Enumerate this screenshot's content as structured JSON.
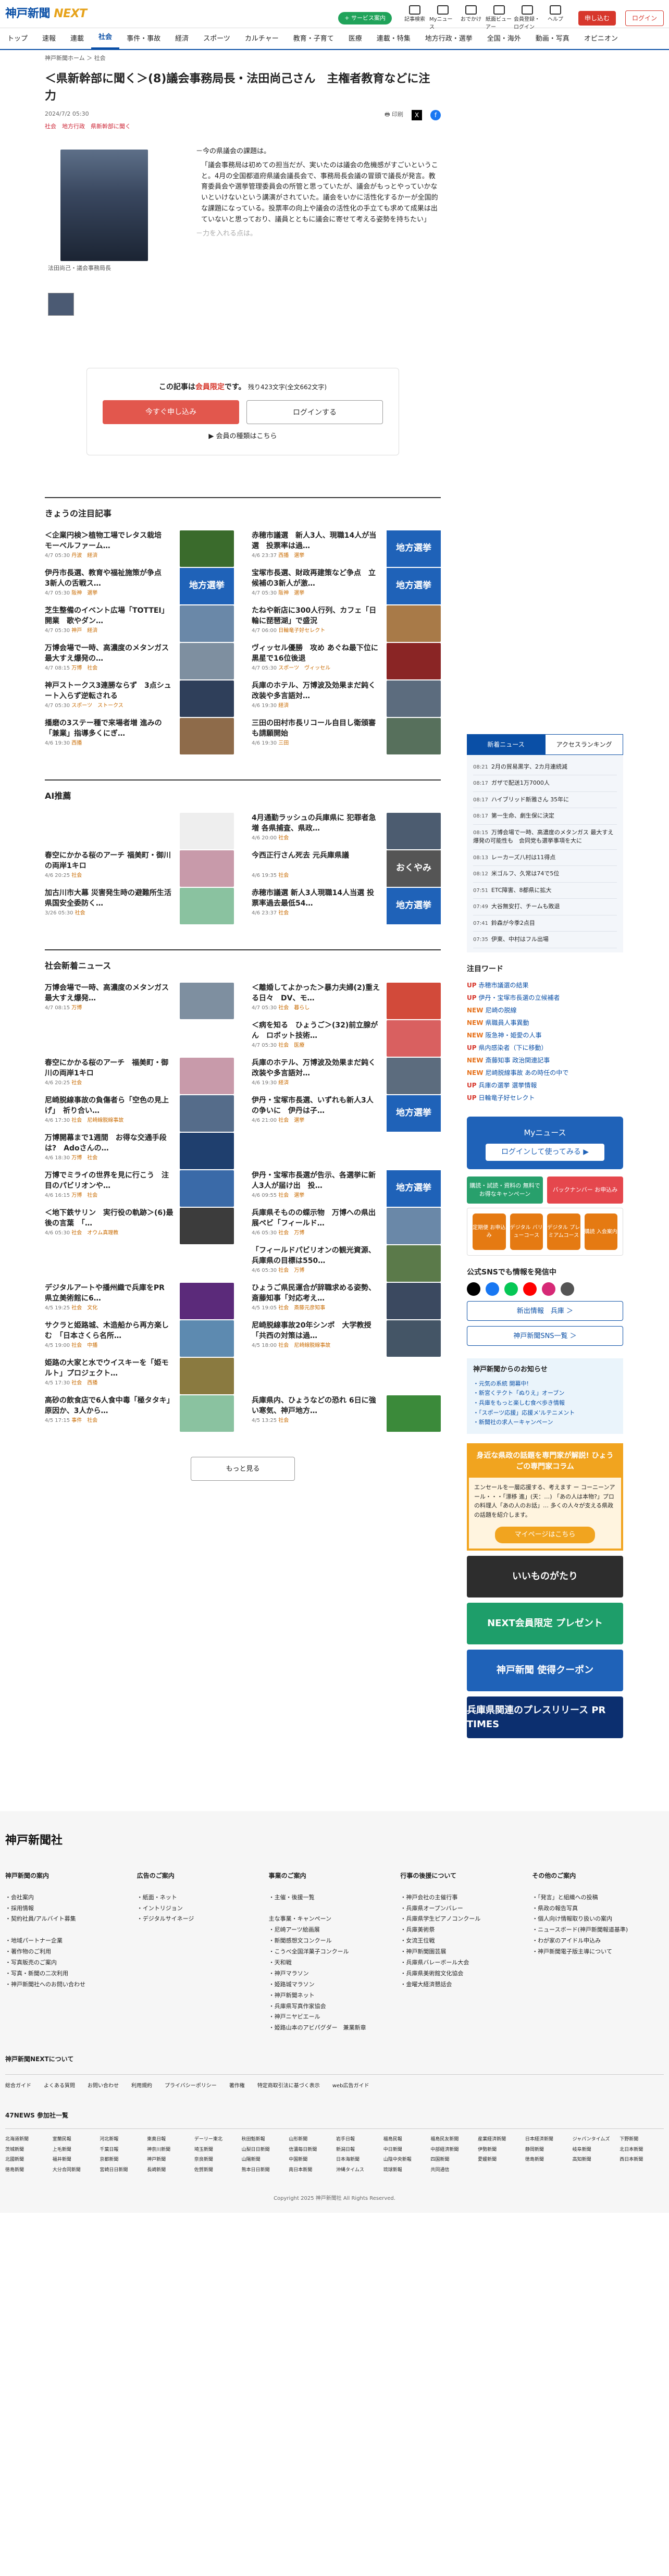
{
  "header": {
    "logo": "神戸新聞",
    "logo_next": "NEXT",
    "digital_pill": "デジタル版",
    "icons": [
      {
        "label": "記事検索",
        "icon": "search-icon"
      },
      {
        "label": "Myニュース",
        "icon": "bookmark-icon"
      },
      {
        "label": "おでかけ",
        "icon": "outing-icon"
      },
      {
        "label": "紙面ビューアー",
        "icon": "viewer-icon"
      },
      {
        "label": "会員登録・ログイン",
        "icon": "user-icon"
      },
      {
        "label": "ヘルプ",
        "icon": "help-icon"
      }
    ],
    "green_pill": "+ サービス案内",
    "register": "申し込む",
    "login": "ログイン"
  },
  "nav": [
    "トップ",
    "速報",
    "連載",
    "社会",
    "事件・事故",
    "経済",
    "スポーツ",
    "カルチャー",
    "教育・子育て",
    "医療",
    "連載・特集",
    "地方行政・選挙",
    "全国・海外",
    "動画・写真",
    "オピニオン"
  ],
  "nav_active": 3,
  "breadcrumb": "神戸新聞ホーム ＞ 社会",
  "article": {
    "title": "＜県新幹部に聞く＞(8)議会事務局長・法田尚己さん　主権者教育などに注力",
    "date": "2024/7/2 05:30",
    "tags": "社会　地方行政　県新幹部に聞く",
    "print": "印刷",
    "caption": "法田尚己・議会事務局長",
    "lead": [
      "－今の県議会の課題は。",
      "「議会事務局は初めての担当だが、実いたのは議会の危機感がすごいということ。4月の全国都道府県議会議長会で、事務局長会議の冒頭で議長が発言。教育委員会や選挙管理委員会の所管と思っていたが、議会がもっとやっていかないといけないという講演がされていた。議会をいかに活性化するかーが全国的な課題になっている。投票率の向上や議会の活性化の手立ても求めて成果は出ていないと思っており、議員とともに議会に寄せて考える姿勢を持ちたい」",
      "－力を入れる点は。"
    ],
    "paywall_text_a": "この記事は",
    "paywall_text_red": "会員限定",
    "paywall_text_b": "です。",
    "paywall_count": "残り423文字(全文662文字)",
    "btn_subscribe": "今すぐ申し込み",
    "btn_login": "ログインする",
    "plans_link": "▶ 会員の種類はこちら"
  },
  "today": {
    "heading": "きょうの注目記事",
    "items": [
      {
        "title": "＜企業円検＞植物工場でレタス栽培　モーベルファーム…",
        "date": "4/7 05:30",
        "tag": "丹波　経済",
        "kind": "photo",
        "color": "#3a6b2c"
      },
      {
        "title": "赤穂市議選　新人3人、現職14人が当選　投票率は過…",
        "date": "4/6 23:37",
        "tag": "西播　選挙",
        "kind": "badge",
        "badge": "地方選挙"
      },
      {
        "title": "伊丹市長選、教育や福祉施策が争点　3新人の舌戦ス…",
        "date": "4/7 05:30",
        "tag": "阪神　選挙",
        "kind": "badge",
        "badge": "地方選挙"
      },
      {
        "title": "宝塚市長選、財政再建策など争点　立候補の3新人が激…",
        "date": "4/7 05:30",
        "tag": "阪神　選挙",
        "kind": "badge",
        "badge": "地方選挙"
      },
      {
        "title": "芝生整備のイベント広場「TOTTEI」開業　歌やダン…",
        "date": "4/7 05:30",
        "tag": "神戸　経済",
        "kind": "photo",
        "color": "#6a88a8"
      },
      {
        "title": "たねや新店に300人行列、カフェ「日輪に琵琶湖」で盛況",
        "date": "4/7 06:00",
        "tag": "日輪竜子好セレクト",
        "kind": "photo",
        "color": "#a87a48"
      },
      {
        "title": "万博会場で一時、高濃度のメタンガス　最大すえ爆発の…",
        "date": "4/7 08:15",
        "tag": "万博　社会",
        "kind": "photo",
        "color": "#7e8fa0"
      },
      {
        "title": "ヴィッセル優勝　攻め あぐね最下位に黒星で16位後退",
        "date": "4/7 05:30",
        "tag": "スポーツ　ヴィッセル",
        "kind": "photo",
        "color": "#8a2525"
      },
      {
        "title": "神戸ストークス3連勝ならず　3点シュート入らず逆転される",
        "date": "4/7 05:30",
        "tag": "スポーツ　ストークス",
        "kind": "photo",
        "color": "#2f3f5a"
      },
      {
        "title": "兵庫のホテル、万博波及効果まだ鈍く　改装や多言語対…",
        "date": "4/6 19:30",
        "tag": "経済",
        "kind": "photo",
        "color": "#5c6c7e"
      },
      {
        "title": "播磨の3ステー種で来場者増 進みの「兼業」指導多くにぎ…",
        "date": "4/6 19:30",
        "tag": "西播",
        "kind": "photo",
        "color": "#8e6b4a"
      },
      {
        "title": "三田の田村市長リコール自目し衛頒審も請願開始",
        "date": "4/6 19:30",
        "tag": "三田",
        "kind": "photo",
        "color": "#57705c"
      }
    ]
  },
  "ai": {
    "heading": "AI推薦",
    "items": [
      {
        "title": "",
        "date": "",
        "tag": "",
        "kind": "gray"
      },
      {
        "title": "4月通勤ラッシュの兵庫県に 犯罪者急増 各県捕査、県政…",
        "date": "4/6 20:00",
        "tag": "社会",
        "kind": "photo",
        "color": "#4c5c70"
      },
      {
        "title": "春空にかかる桜のアーチ 福美町・御川の両岸1キロ",
        "date": "4/6 20:25",
        "tag": "社会",
        "kind": "photo",
        "color": "#c89aaa"
      },
      {
        "title": "今西正行さん死去 元兵庫県議",
        "date": "4/6 19:35",
        "tag": "社会",
        "kind": "badge2",
        "badge": "おくやみ"
      },
      {
        "title": "加古川市大幕 災害発生時の避難所生活 県国安全委防く…",
        "date": "3/26 05:30",
        "tag": "社会",
        "kind": "map",
        "color": "#8ac2a0"
      },
      {
        "title": "赤穂市議選 新人3人現職14人当選 投票率過去最低54…",
        "date": "4/6 23:37",
        "tag": "社会",
        "kind": "badge",
        "badge": "地方選挙"
      }
    ]
  },
  "social": {
    "heading": "社会新着ニュース",
    "items": [
      {
        "title": "万博会場で一時、高濃度のメタンガス　最大すえ爆発…",
        "date": "4/7 08:15",
        "tag": "万博",
        "kind": "photo",
        "color": "#7e8fa0"
      },
      {
        "title": "＜離婚してよかった＞暴力夫婦(2)重える日々　DV、モ…",
        "date": "4/7 05:30",
        "tag": "社会　暮らし",
        "kind": "photo",
        "color": "#d24a3a"
      },
      {
        "title": "",
        "date": "",
        "tag": "",
        "kind": "none"
      },
      {
        "title": "＜病を知る　ひょうご＞(32)前立腺がん　ロボット技術…",
        "date": "4/7 05:30",
        "tag": "社会　医療",
        "kind": "photo",
        "color": "#d96060"
      },
      {
        "title": "春空にかかる桜のアーチ　福美町・御川の両岸1キロ",
        "date": "4/6 20:25",
        "tag": "社会",
        "kind": "photo",
        "color": "#c89aaa"
      },
      {
        "title": "兵庫のホテル、万博波及効果まだ鈍く　改装や多言語対…",
        "date": "4/6 19:30",
        "tag": "経済",
        "kind": "photo",
        "color": "#5c6c7e"
      },
      {
        "title": "尼崎脱線事故の負傷者ら「空色の見上げ」　祈り合い…",
        "date": "4/6 17:30",
        "tag": "社会　尼崎線脱線事故",
        "kind": "photo",
        "color": "#556c8a"
      },
      {
        "title": "伊丹・宝塚市長選、いずれも新人3人の争いに　伊丹は子…",
        "date": "4/6 21:00",
        "tag": "社会　選挙",
        "kind": "badge",
        "badge": "地方選挙"
      },
      {
        "title": "万博開幕まで1週間　お得な交通手段は?　Adoさんの…",
        "date": "4/6 18:30",
        "tag": "万博　社会",
        "kind": "photo",
        "color": "#1f3f6e"
      },
      {
        "title": "",
        "date": "",
        "tag": "",
        "kind": "none"
      },
      {
        "title": "万博でミライの世界を見に行こう　注目のパビリオンや…",
        "date": "4/6 16:15",
        "tag": "万博　社会",
        "kind": "photo",
        "color": "#3a6aa8"
      },
      {
        "title": "伊丹・宝塚市長選が告示、各選挙に新人3人が届け出　投…",
        "date": "4/6 09:55",
        "tag": "社会　選挙",
        "kind": "badge",
        "badge": "地方選挙"
      },
      {
        "title": "＜地下鉄サリン　実行役の軌跡＞(6)最後の言葉　「…",
        "date": "4/6 05:30",
        "tag": "社会　オウム真理教",
        "kind": "photo",
        "color": "#3c3c3c"
      },
      {
        "title": "兵庫県そものの蝶示物　万博への県出展ペビ「フィールド…",
        "date": "4/6 05:30",
        "tag": "社会　万博",
        "kind": "photo",
        "color": "#6a88a8"
      },
      {
        "title": "",
        "date": "",
        "tag": "",
        "kind": "none"
      },
      {
        "title": "「フィールドパビリオンの観光資源、兵庫県の目標は550…",
        "date": "4/6 05:30",
        "tag": "社会　万博",
        "kind": "photo",
        "color": "#5b7a4a"
      },
      {
        "title": "デジタルアートや播州織で兵庫をPR　県立美術館に6…",
        "date": "4/5 19:25",
        "tag": "社会　文化",
        "kind": "photo",
        "color": "#5b2a7a"
      },
      {
        "title": "ひょうご県民運合が辞職求める姿勢、斎藤知事「対応考え…",
        "date": "4/5 19:05",
        "tag": "社会　斎藤元彦知事",
        "kind": "photo",
        "color": "#3b4960"
      },
      {
        "title": "サクラと姫路城、木造船から再方楽しむ　「日本さくら名所…",
        "date": "4/5 19:00",
        "tag": "社会　中播",
        "kind": "photo",
        "color": "#5d8ab0"
      },
      {
        "title": "尼崎脱線事故20年シンポ　大学教授「共西の対策は過…",
        "date": "4/5 18:00",
        "tag": "社会　尼崎線脱線事故",
        "kind": "photo",
        "color": "#445566"
      },
      {
        "title": "姫路の大家と水でウイスキーを「姫モルト」プロジェクト…",
        "date": "4/5 17:30",
        "tag": "社会　西播",
        "kind": "photo",
        "color": "#8a7a40"
      },
      {
        "title": "",
        "date": "",
        "tag": "",
        "kind": "none"
      },
      {
        "title": "高砂の飲食店で6人食中毒「極タタキ」原因か、3人から…",
        "date": "4/5 17:15",
        "tag": "事件　社会",
        "kind": "map",
        "color": "#8ac2a0"
      },
      {
        "title": "兵庫県内、ひょうなどの恐れ 6日に強い寒気、神戸地方…",
        "date": "4/5 13:25",
        "tag": "社会",
        "kind": "photo",
        "color": "#3b8a3a"
      }
    ],
    "more": "もっと見る"
  },
  "side": {
    "tabs": [
      "新着ニュース",
      "アクセスランキング"
    ],
    "news": [
      {
        "d": "08:21",
        "t": "2月の貿易黒字、2カ月連続減"
      },
      {
        "d": "08:17",
        "t": "ガザで配送1万7000人"
      },
      {
        "d": "08:17",
        "t": "ハイブリッド新雅さん 35年に"
      },
      {
        "d": "08:17",
        "t": "第一生命、劇生保に決定"
      },
      {
        "d": "08:15",
        "t": "万博会場で一時、高濃度のメタンガス 最大すえ爆発の可能性も　会同党も選挙事項を大に"
      },
      {
        "d": "08:13",
        "t": "レーカーズ八村は11得点"
      },
      {
        "d": "08:12",
        "t": "米ゴルフ、久常は74で5位"
      },
      {
        "d": "07:51",
        "t": "ETC障害、8都県に拡大"
      },
      {
        "d": "07:49",
        "t": "大谷無安打、チームも敗退"
      },
      {
        "d": "07:41",
        "t": "鈴森が今季2点目"
      },
      {
        "d": "07:35",
        "t": "伊東、中村はフル出場"
      }
    ],
    "kw_heading": "注目ワード",
    "keywords": [
      {
        "m": "UP",
        "t": "赤穂市議選の結果"
      },
      {
        "m": "UP",
        "t": "伊丹・宝塚市長選の立候補者"
      },
      {
        "m": "NEW",
        "t": "尼崎の脱線"
      },
      {
        "m": "NEW",
        "t": "県職員人事異動"
      },
      {
        "m": "NEW",
        "t": "阪急神・姫愛の人事"
      },
      {
        "m": "UP",
        "t": "県内感染者（下に移動）"
      },
      {
        "m": "NEW",
        "t": "斎藤知事 政治関連記事"
      },
      {
        "m": "NEW",
        "t": "尼崎脱線事故 あの時任の中で"
      },
      {
        "m": "UP",
        "t": "兵庫の選挙 選挙情報"
      },
      {
        "m": "UP",
        "t": "日輪竜子好セレクト"
      }
    ],
    "my_clip": "Myニュース",
    "my_clip_btn": "ログインして使ってみる ▶",
    "cp": [
      "購読・試読・資料の\n無料でお得なキャンペーン",
      "バックナンバー\nお申込み"
    ],
    "pm": [
      "定期便\nお申込み",
      "デジタル\nバリューコース",
      "デジタル\nプレミアムコース",
      "購読\n入会案内"
    ],
    "pm_head": "デジタル",
    "sns_heading": "公式SNSでも情報を発信中",
    "sns_btn1": "新出情報　兵庫 ＞",
    "sns_btn2": "神戸新聞SNS一覧 ＞",
    "info_heading": "神戸新聞からのお知らせ",
    "info": [
      "・元気の系統 開幕中!",
      "・新宮くテクト「ぬりえ」オーブン",
      "・兵庫をもっと楽しむ食べ歩き情報",
      "・「スポーツ応援」応援メ'ルテニメント",
      "・新聞社の求人ーキャンペーン"
    ],
    "col_head": "身近な県政の話題を専門家が解説!\nひょうごの専門家コラム",
    "col_body": "エンセールを一層応援する、考えます ー\nコーニーンアール・・・「漂移 進」(天：…)\n「あの人は本物?」プロの料理人「あの人のお話」…\n多くの人々が支える県政の話題を紹介します。",
    "col_btn": "マイページはこちら",
    "banners": [
      {
        "t": "いいものがたり",
        "c": "#2d2d2d"
      },
      {
        "t": "NEXT会員限定 プレゼント",
        "c": "#1e9e6a"
      },
      {
        "t": "神戸新聞 使得クーポン",
        "c": "#1f62b8"
      },
      {
        "t": "兵庫県関連のプレスリリース PR TIMES",
        "c": "#0c2f6f"
      }
    ]
  },
  "footer": {
    "logo": "神戸新聞社",
    "cols": [
      {
        "h": "神戸新聞の案内",
        "items": [
          "・会社案内",
          "・採用情報",
          "・契約社員/アルバイト募集",
          "",
          "・地域パートナー企業",
          "・著作物のご利用",
          "・写真販売のご案内",
          "・写真・新聞の二次利用",
          "・神戸新聞社へのお問い合わせ"
        ]
      },
      {
        "h": "広告のご案内",
        "items": [
          "・紙面・ネット",
          "・イントリジョン",
          "・デジタルサイネージ"
        ]
      },
      {
        "h": "事業のご案内",
        "items": [
          "・主催・後援一覧",
          "",
          "主な事業・キャンペーン",
          "・尼崎アーツ絵画展",
          "・新聞感想文コンクール",
          "・こうべ全国洋菓子コンクール",
          "・天和戦",
          "・神戸マラソン",
          "・姫路城マラソン",
          "・神戸新聞ネット",
          "・兵庫県写真作家協会",
          "・神戸ニヤビエール",
          "・姫路山本のアビパグダー　兼業新章"
        ]
      },
      {
        "h": "行事の後援について",
        "items": [
          "・神戸会社の主催行事",
          "・兵庫県オープンバレー",
          "・兵庫県学生ピアノコンクール",
          "・兵庫美術祭",
          "・女流王位戦",
          "・神戸新聞園芸展",
          "・兵庫県バレーボール大会",
          "・兵庫県美術館文化協会",
          "・金曜大経済懇話会"
        ]
      },
      {
        "h": "その他のご案内",
        "items": [
          "・「発言」と組織への投稿",
          "・県政の報告写真",
          "・個人向け情報取り扱いの案内",
          "・ニュースボード(神戸新聞報道基準)",
          "・わが家のアイドル申込み",
          "・神戸新聞電子版主導について"
        ]
      }
    ],
    "next_h": "神戸新聞NEXTについて",
    "next_links": [
      "総合ガイド",
      "よくある質問",
      "お問い合わせ",
      "利用規約",
      "プライバシーポリシー",
      "著作権",
      "特定商取引法に基づく表示",
      "web広告ガイド"
    ],
    "n47_h": "47NEWS 参加社一覧",
    "n47": [
      "北海道新聞",
      "室蘭民報",
      "河北新報",
      "東奥日報",
      "デーリー東北",
      "秋田魁新報",
      "山形新聞",
      "岩手日報",
      "福島民報",
      "福島民友新聞",
      "産業経済新聞",
      "日本経済新聞",
      "ジャパンタイムズ",
      "下野新聞",
      "茨城新聞",
      "上毛新聞",
      "千葉日報",
      "神奈川新聞",
      "埼玉新聞",
      "山梨日日新聞",
      "信濃毎日新聞",
      "新潟日報",
      "中日新聞",
      "中部経済新聞",
      "伊勢新聞",
      "静岡新聞",
      "岐阜新聞",
      "北日本新聞",
      "北國新聞",
      "福井新聞",
      "京都新聞",
      "神戸新聞",
      "奈良新聞",
      "山陽新聞",
      "中国新聞",
      "日本海新聞",
      "山陰中央新報",
      "四国新聞",
      "愛媛新聞",
      "徳島新聞",
      "高知新聞",
      "西日本新聞",
      "徳島新聞",
      "大分合同新聞",
      "宮崎日日新聞",
      "長崎新聞",
      "佐賀新聞",
      "熊本日日新聞",
      "南日本新聞",
      "沖縄タイムス",
      "琉球新報",
      "共同通信"
    ],
    "copy": "Copyright 2025 神戸新聞社 All Rights Reserved."
  }
}
